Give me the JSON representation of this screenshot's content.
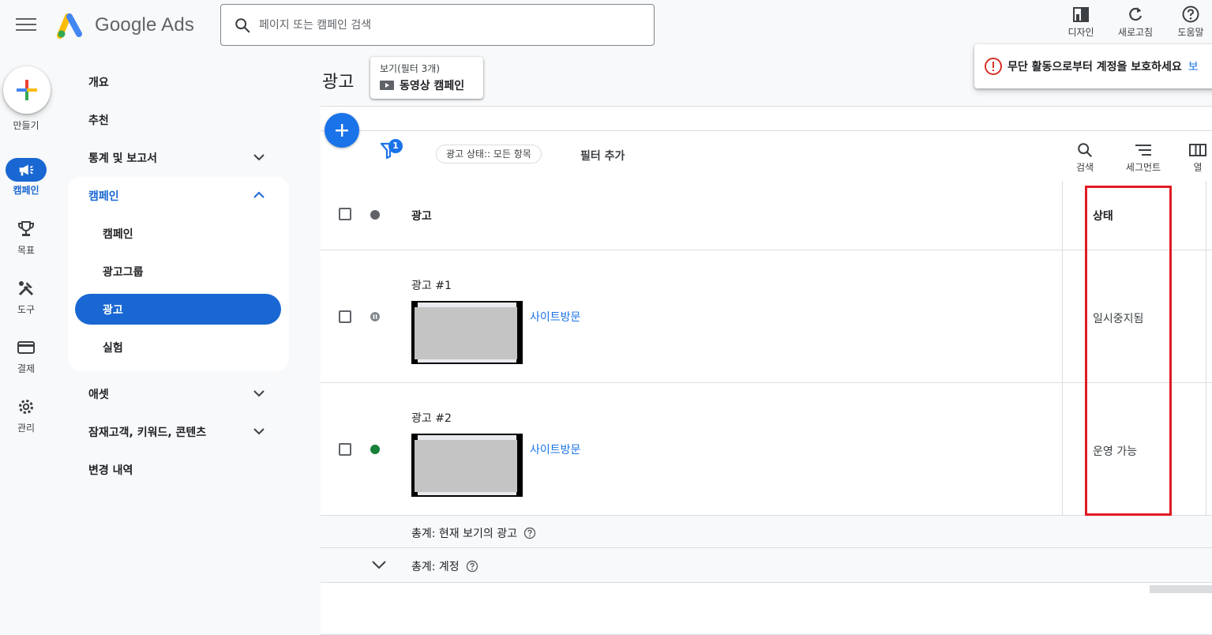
{
  "header": {
    "logo_text": "Google Ads",
    "search_placeholder": "페이지 또는 캠페인 검색",
    "actions": [
      {
        "label": "디자인",
        "icon": "appearance-icon"
      },
      {
        "label": "새로고침",
        "icon": "refresh-icon"
      },
      {
        "label": "도움말",
        "icon": "help-icon"
      }
    ]
  },
  "rail": {
    "create_label": "만들기",
    "items": [
      {
        "label": "캠페인",
        "icon": "campaign-icon",
        "active": true
      },
      {
        "label": "목표",
        "icon": "trophy-icon"
      },
      {
        "label": "도구",
        "icon": "tools-icon"
      },
      {
        "label": "결제",
        "icon": "billing-icon"
      },
      {
        "label": "관리",
        "icon": "gear-icon"
      }
    ]
  },
  "nav": {
    "overview": "개요",
    "recommendations": "추천",
    "reports": "통계 및 보고서",
    "campaigns_group": "캠페인",
    "campaigns_sub": [
      "캠페인",
      "광고그룹",
      "광고",
      "실험"
    ],
    "assets": "애셋",
    "audiences": "잠재고객, 키워드, 콘텐츠",
    "change_history": "변경 내역"
  },
  "main": {
    "page_title": "광고",
    "view_chip": {
      "small": "보기(필터 3개)",
      "label": "동영상 캠페인"
    },
    "notice": {
      "text": "무단 활동으로부터 계정을 보호하세요",
      "link": "보"
    },
    "filter": {
      "badge": "1",
      "chip": "광고 상태:: 모든 항목",
      "add": "필터 추가"
    },
    "tools": [
      {
        "label": "검색",
        "icon": "search-icon"
      },
      {
        "label": "세그먼트",
        "icon": "segment-icon"
      },
      {
        "label": "열",
        "icon": "columns-icon"
      }
    ],
    "table": {
      "header": {
        "ad": "광고",
        "status": "상태"
      },
      "rows": [
        {
          "name": "광고 #1",
          "link": "사이트방문",
          "status": "일시중지됨",
          "status_color": "#80868b"
        },
        {
          "name": "광고 #2",
          "link": "사이트방문",
          "status": "운영 가능",
          "status_color": "#188038"
        }
      ],
      "totals": [
        "총계: 현재 보기의 광고",
        "총계: 계정"
      ]
    }
  },
  "colors": {
    "accent": "#1967d2",
    "highlight": "#e01b24"
  }
}
